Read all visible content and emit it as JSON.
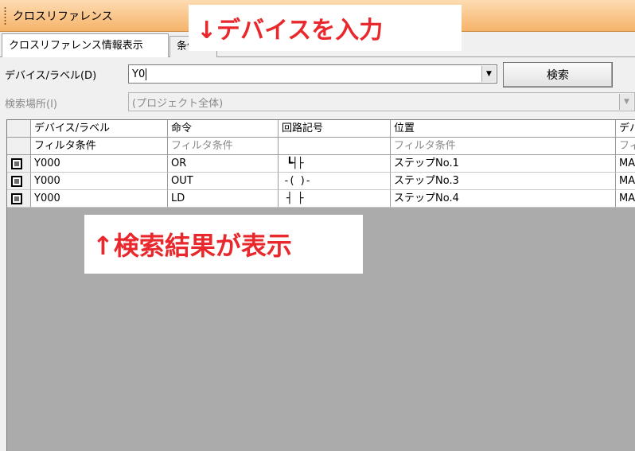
{
  "window": {
    "title": "クロスリファレンス"
  },
  "tabs": [
    {
      "label": "クロスリファレンス情報表示"
    },
    {
      "label": "条件設定"
    }
  ],
  "device_row": {
    "label": "デバイス/ラベル(D)",
    "value": "Y0",
    "search_button": "検索"
  },
  "location_row": {
    "label": "検索場所(I)",
    "value": "(プロジェクト全体)"
  },
  "grid": {
    "columns": [
      "デバイス/ラベル",
      "命令",
      "回路記号",
      "位置",
      "デバイスコメント"
    ],
    "filter": [
      "フィルタ条件",
      "フィルタ条件",
      "",
      "フィルタ条件",
      "フィルタ条件"
    ],
    "rows": [
      {
        "device": "Y000",
        "instruction": "OR",
        "symbol": "┗┤├",
        "position": "ステップNo.1",
        "extra": "MAIN"
      },
      {
        "device": "Y000",
        "instruction": "OUT",
        "symbol": "-( )-",
        "position": "ステップNo.3",
        "extra": "MAIN"
      },
      {
        "device": "Y000",
        "instruction": "LD",
        "symbol": "┤ ├",
        "position": "ステップNo.4",
        "extra": "MAIN"
      }
    ]
  },
  "annotations": {
    "top": "↓デバイスを入力",
    "bottom": "↑検索結果が表示"
  },
  "colors": {
    "title_bar": "#f6b36a",
    "callout_text": "#e8282c",
    "grid_background": "#ababab"
  }
}
